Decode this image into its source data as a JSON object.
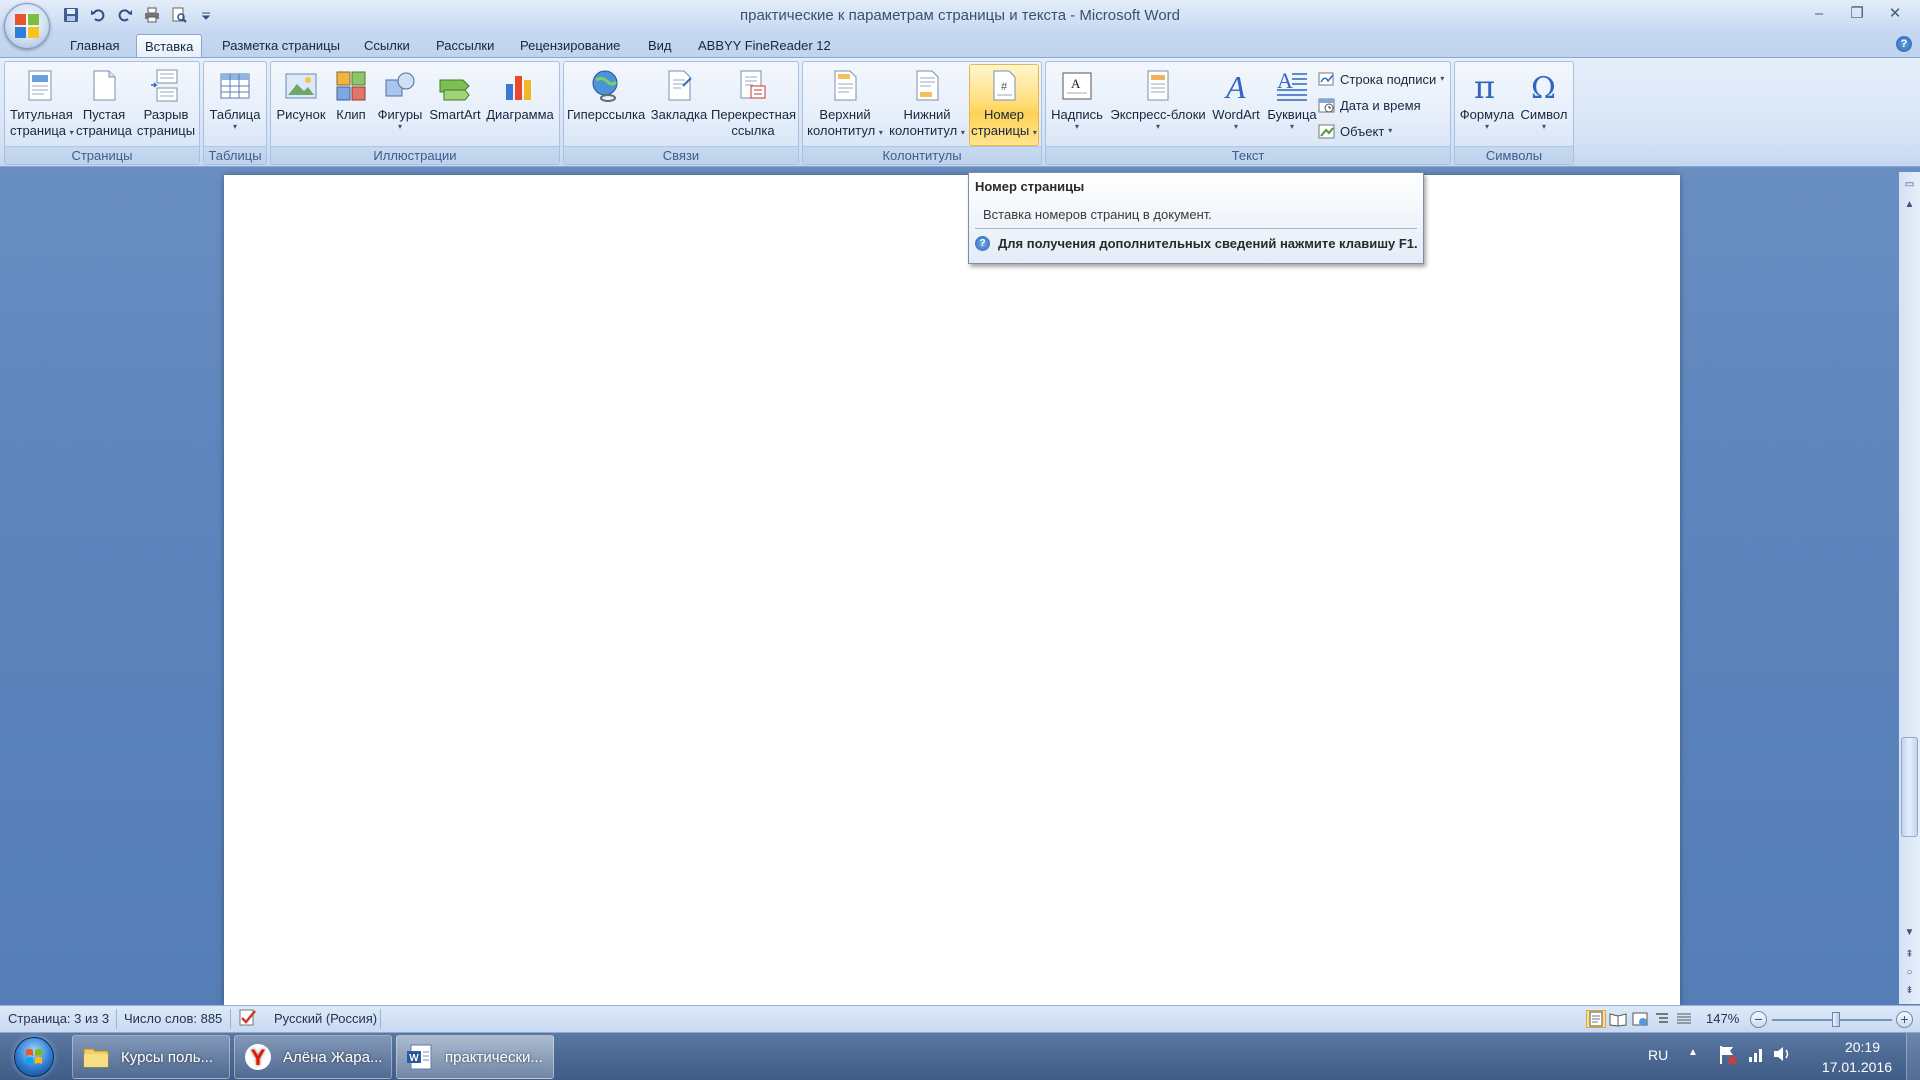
{
  "window": {
    "title": "практические к параметрам страницы и текста - Microsoft Word"
  },
  "tabs": [
    {
      "label": "Главная"
    },
    {
      "label": "Вставка",
      "active": true
    },
    {
      "label": "Разметка страницы"
    },
    {
      "label": "Ссылки"
    },
    {
      "label": "Рассылки"
    },
    {
      "label": "Рецензирование"
    },
    {
      "label": "Вид"
    },
    {
      "label": "ABBYY FineReader 12"
    }
  ],
  "ribbon": {
    "groups": [
      {
        "label": "Страницы",
        "buttons": [
          {
            "line1": "Титульная",
            "line2": "страница"
          },
          {
            "line1": "Пустая",
            "line2": "страница"
          },
          {
            "line1": "Разрыв",
            "line2": "страницы"
          }
        ]
      },
      {
        "label": "Таблицы",
        "buttons": [
          {
            "line1": "Таблица"
          }
        ]
      },
      {
        "label": "Иллюстрации",
        "buttons": [
          {
            "line1": "Рисунок"
          },
          {
            "line1": "Клип"
          },
          {
            "line1": "Фигуры"
          },
          {
            "line1": "SmartArt"
          },
          {
            "line1": "Диаграмма"
          }
        ]
      },
      {
        "label": "Связи",
        "buttons": [
          {
            "line1": "Гиперссылка"
          },
          {
            "line1": "Закладка"
          },
          {
            "line1": "Перекрестная",
            "line2": "ссылка"
          }
        ]
      },
      {
        "label": "Колонтитулы",
        "buttons": [
          {
            "line1": "Верхний",
            "line2": "колонтитул"
          },
          {
            "line1": "Нижний",
            "line2": "колонтитул"
          },
          {
            "line1": "Номер",
            "line2": "страницы"
          }
        ]
      },
      {
        "label": "Текст",
        "buttons": [
          {
            "line1": "Надпись"
          },
          {
            "line1": "Экспресс-блоки"
          },
          {
            "line1": "WordArt"
          },
          {
            "line1": "Буквица"
          }
        ],
        "small": [
          {
            "label": "Строка подписи"
          },
          {
            "label": "Дата и время"
          },
          {
            "label": "Объект"
          }
        ]
      },
      {
        "label": "Символы",
        "buttons": [
          {
            "line1": "Формула"
          },
          {
            "line1": "Символ"
          }
        ]
      }
    ]
  },
  "tooltip": {
    "title": "Номер страницы",
    "description": "Вставка номеров страниц в документ.",
    "help": "Для получения дополнительных сведений нажмите клавишу F1."
  },
  "statusbar": {
    "page": "Страница: 3 из 3",
    "words": "Число слов: 885",
    "language": "Русский (Россия)",
    "zoom": "147%"
  },
  "taskbar": {
    "apps": [
      {
        "label": "Курсы поль..."
      },
      {
        "label": "Алёна Жара..."
      },
      {
        "label": "практически..."
      }
    ],
    "lang": "RU",
    "time": "20:19",
    "date": "17.01.2016"
  }
}
